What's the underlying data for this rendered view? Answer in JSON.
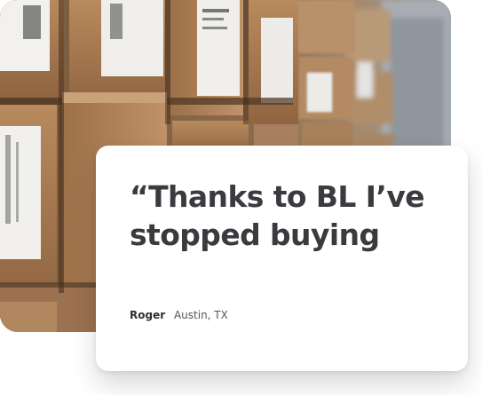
{
  "photo": {
    "subject": "stacked-cardboard-boxes"
  },
  "testimonial": {
    "quote_line_1": "“Thanks to BL I’ve",
    "quote_line_2": "stopped buying",
    "author_name": "Roger",
    "author_location": "Austin, TX"
  },
  "colors": {
    "card_background": "#ffffff",
    "text": "#3a3b3f",
    "cardboard": "#a87c54"
  }
}
